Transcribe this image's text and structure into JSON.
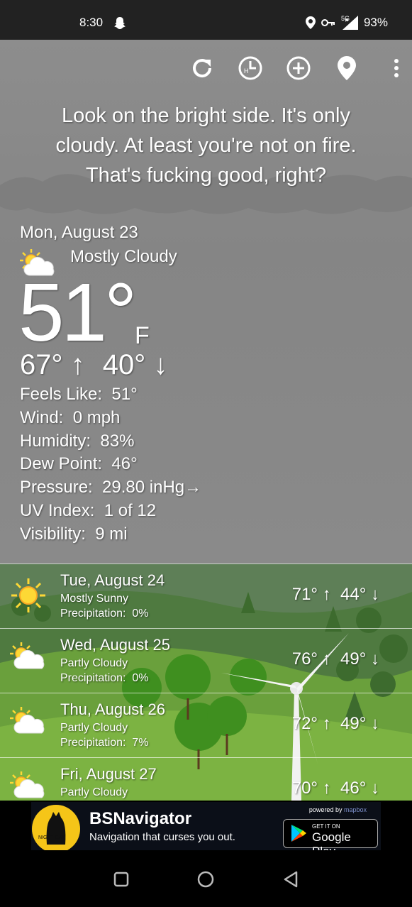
{
  "status_bar": {
    "time": "8:30",
    "network_label": "5G",
    "battery": "93%",
    "icons": [
      "snapchat-ghost-icon",
      "location-icon",
      "vpn-key-icon",
      "signal-icon"
    ]
  },
  "toolbar": {
    "icons": [
      "refresh-icon",
      "hourly-clock-icon",
      "add-location-icon",
      "location-pin-icon",
      "more-vert-icon"
    ]
  },
  "quote": {
    "line1": "Look on the bright side. It's only",
    "line2": "cloudy. At least you're not on fire.",
    "line3": "That's fucking good, right?"
  },
  "current": {
    "date": "Mon, August 23",
    "condition": "Mostly Cloudy",
    "condition_icon": "partly-cloudy-icon",
    "temperature": "51°",
    "unit": "F",
    "high": "67°",
    "low": "40°",
    "details": [
      {
        "label": "Feels Like:",
        "value": "51°"
      },
      {
        "label": "Wind:",
        "value": "0 mph"
      },
      {
        "label": "Humidity:",
        "value": "83%"
      },
      {
        "label": "Dew Point:",
        "value": "46°"
      },
      {
        "label": "Pressure:",
        "value": "29.80 inHg→"
      },
      {
        "label": "UV Index:",
        "value": "1 of 12"
      },
      {
        "label": "Visibility:",
        "value": "9 mi"
      }
    ]
  },
  "forecast": [
    {
      "date": "Tue, August 24",
      "condition": "Mostly Sunny",
      "precip_label": "Precipitation:",
      "precip": "0%",
      "high": "71°",
      "low": "44°",
      "icon": "sun-icon"
    },
    {
      "date": "Wed, August 25",
      "condition": "Partly Cloudy",
      "precip_label": "Precipitation:",
      "precip": "0%",
      "high": "76°",
      "low": "49°",
      "icon": "partly-cloudy-icon"
    },
    {
      "date": "Thu, August 26",
      "condition": "Partly Cloudy",
      "precip_label": "Precipitation:",
      "precip": "7%",
      "high": "72°",
      "low": "49°",
      "icon": "partly-cloudy-icon"
    },
    {
      "date": "Fri, August 27",
      "condition": "Partly Cloudy",
      "precip_label": "",
      "precip": "",
      "high": "70°",
      "low": "46°",
      "icon": "partly-cloudy-icon"
    }
  ],
  "arrows": {
    "up": "↑",
    "down": "↓"
  },
  "ad": {
    "title": "BSNavigator",
    "subtitle": "Navigation that curses you out.",
    "powered_by": "powered by",
    "powered_brand": "mapbox",
    "badge_small": "GET IT ON",
    "badge_name": "Google Play",
    "logo_text": "NIGHT CAT"
  },
  "nav_bar": {
    "icons": [
      "recent-apps-icon",
      "home-icon",
      "back-icon"
    ]
  },
  "colors": {
    "sky": "#8a8a8a",
    "grass": "#7cb342",
    "sun": "#fdd835",
    "ad_bg": "#0b0f18"
  }
}
